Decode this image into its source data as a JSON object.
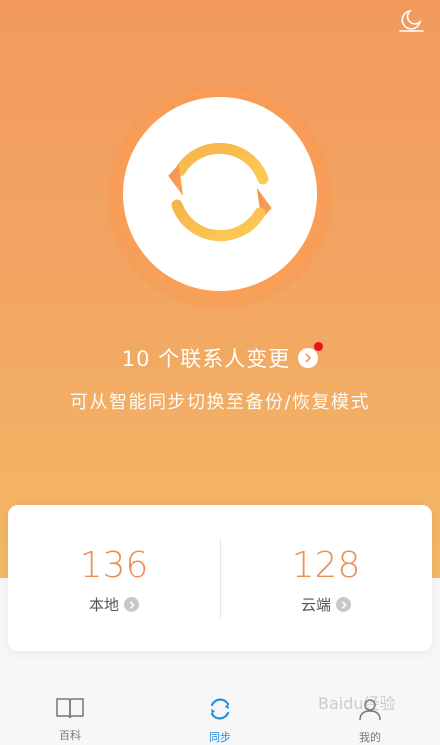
{
  "header": {
    "night_mode_icon": "moon-icon"
  },
  "sync": {
    "icon": "sync-arrows-icon",
    "changes_text": "10 个联系人变更",
    "changes_icon": "chevron-right-icon",
    "hint": "可从智能同步切换至备份/恢复模式"
  },
  "stats": {
    "local": {
      "count": "136",
      "label": "本地"
    },
    "cloud": {
      "count": "128",
      "label": "云端"
    }
  },
  "tabs": [
    {
      "label": "百科",
      "icon": "book-icon",
      "active": false
    },
    {
      "label": "同步",
      "icon": "sync-icon",
      "active": true
    },
    {
      "label": "我的",
      "icon": "person-icon",
      "active": false
    }
  ],
  "watermark": "Baidu经验",
  "colors": {
    "accent_orange": "#ef8c52",
    "active_tab_blue": "#1f8fe0",
    "notification_red": "#e8141b"
  }
}
